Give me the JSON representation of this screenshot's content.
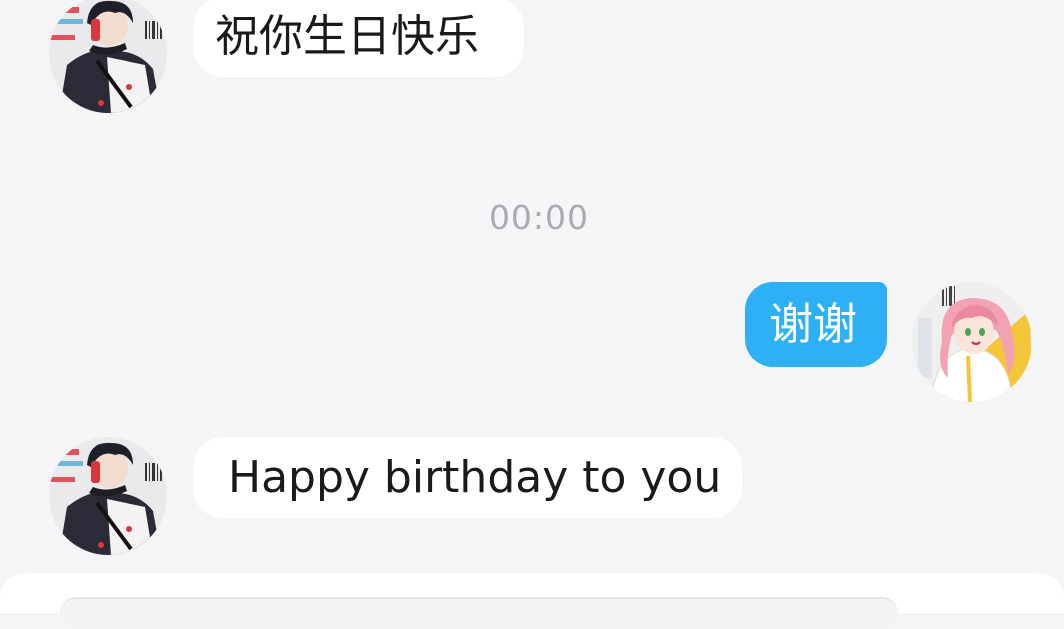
{
  "messages": [
    {
      "direction": "incoming",
      "sender_avatar": "friend-avatar",
      "text": "祝你生日快乐"
    },
    {
      "type": "timestamp",
      "text": "00:00"
    },
    {
      "direction": "outgoing",
      "sender_avatar": "self-avatar",
      "text": "谢谢"
    },
    {
      "direction": "incoming",
      "sender_avatar": "friend-avatar",
      "text": "Happy birthday to you"
    }
  ],
  "colors": {
    "background": "#f4f5f7",
    "incoming_bubble": "#ffffff",
    "outgoing_bubble": "#2db0f6",
    "timestamp_text": "#a9abae"
  }
}
